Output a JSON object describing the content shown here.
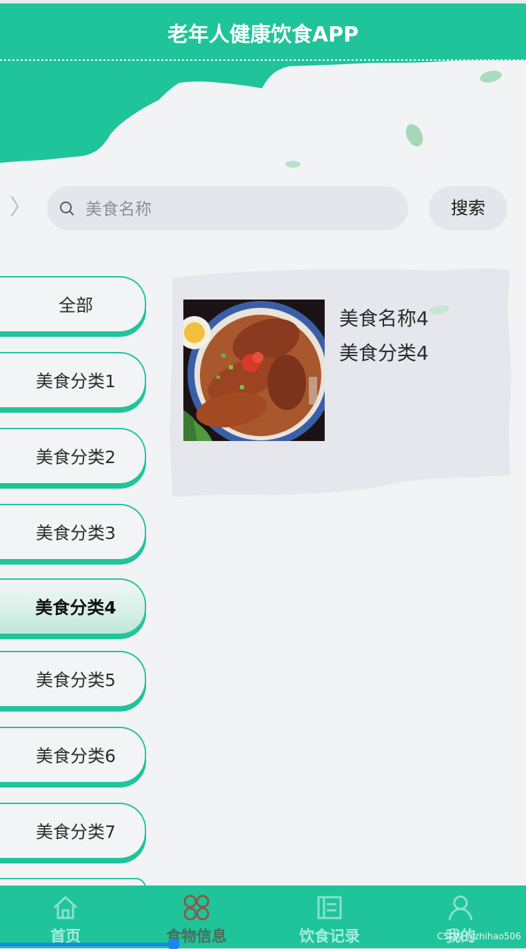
{
  "header": {
    "title": "老年人健康饮食APP"
  },
  "search": {
    "placeholder": "美食名称",
    "button_label": "搜索"
  },
  "categories": [
    {
      "label": "全部",
      "active": false
    },
    {
      "label": "美食分类1",
      "active": false
    },
    {
      "label": "美食分类2",
      "active": false
    },
    {
      "label": "美食分类3",
      "active": false
    },
    {
      "label": "美食分类4",
      "active": true
    },
    {
      "label": "美食分类5",
      "active": false
    },
    {
      "label": "美食分类6",
      "active": false
    },
    {
      "label": "美食分类7",
      "active": false
    }
  ],
  "food_items": [
    {
      "name": "美食名称4",
      "category": "美食分类4"
    }
  ],
  "bottom_nav": [
    {
      "label": "首页",
      "icon": "home-icon",
      "active": false
    },
    {
      "label": "食物信息",
      "icon": "grid-icon",
      "active": true
    },
    {
      "label": "饮食记录",
      "icon": "list-icon",
      "active": false
    },
    {
      "label": "我的",
      "icon": "user-icon",
      "active": false
    }
  ],
  "watermark": "CSDN @zhihao506",
  "colors": {
    "primary": "#20c49a",
    "background": "#f2f3f5",
    "nav_label": "#a6ece0",
    "nav_active_icon": "#8a5a4a"
  }
}
